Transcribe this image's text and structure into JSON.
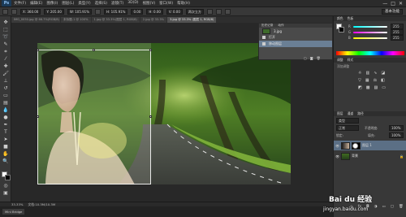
{
  "menubar": {
    "logo": "Ps",
    "items": [
      "文件(F)",
      "编辑(E)",
      "图像(I)",
      "图层(L)",
      "类型(Y)",
      "选择(S)",
      "滤镜(T)",
      "3D(D)",
      "视图(V)",
      "窗口(W)",
      "帮助(H)"
    ],
    "window_buttons": [
      "—",
      "□",
      "✕"
    ]
  },
  "options": {
    "x_value": "X: 360.00",
    "y_value": "Y: 205.00",
    "w_value": "W: 105.91%",
    "h_value": "H: 105.91%",
    "angle_value": "0.00",
    "h_skew": "H: 0.00",
    "v_skew": "V: 0.00",
    "interp": "两次立方",
    "workspace": "基本功能"
  },
  "tabs": [
    {
      "label": "IMG_0050.jpg @ 66.7%(RGB/8)",
      "active": false
    },
    {
      "label": "未标题-1 @ 100%",
      "active": false
    },
    {
      "label": "1.jpg @ 33.3%(图层 1, RGB/8)",
      "active": false
    },
    {
      "label": "2.jpg @ 33.3%",
      "active": false
    },
    {
      "label": "3.jpg @ 33.3% (图层 1, RGB/8)",
      "active": true
    }
  ],
  "history": {
    "tabs": [
      "历史记录",
      "动作"
    ],
    "rows": [
      {
        "label": "3.jpg",
        "type": "snapshot"
      },
      {
        "label": "打开",
        "type": "step"
      },
      {
        "label": "移动图层",
        "type": "step",
        "selected": true
      }
    ]
  },
  "color_panel": {
    "tabs": [
      "颜色",
      "色板"
    ],
    "labels": [
      "R",
      "G",
      "B"
    ],
    "values": [
      "255",
      "255",
      "255"
    ]
  },
  "adjust_panel": {
    "tabs": [
      "调整",
      "样式"
    ],
    "title": "添加调整"
  },
  "layers_panel": {
    "tabs": [
      "图层",
      "通道",
      "路径"
    ],
    "kind_label": "类型",
    "blend_mode": "正常",
    "opacity_label": "不透明度:",
    "opacity": "100%",
    "lock_label": "锁定:",
    "fill_label": "填充:",
    "fill": "100%",
    "layers": [
      {
        "name": "图层 1",
        "selected": true,
        "has_mask": true
      },
      {
        "name": "背景",
        "selected": false,
        "locked": true
      }
    ]
  },
  "status": {
    "zoom": "33.33%",
    "doc": "文档:10.3M/10.3M"
  },
  "bottom": {
    "bridge": "Mini Bridge",
    "watermark": "jingyan.baidu.com",
    "watermark_brand": "Bai du 经验"
  },
  "colors": {
    "accent_selected": "#5b6f85",
    "fg_swatch": "#ffffff",
    "bg_swatch": "#000000"
  }
}
